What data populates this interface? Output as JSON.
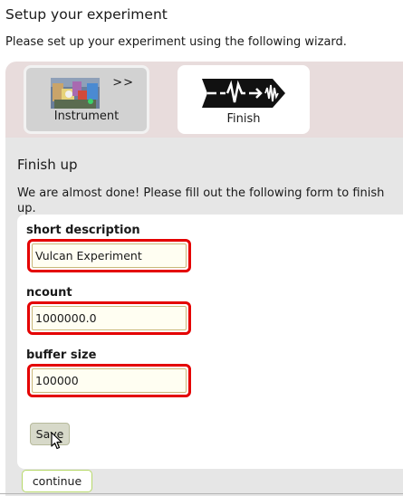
{
  "page": {
    "title": "Setup your experiment",
    "intro": "Please set up your experiment using the following wizard."
  },
  "wizard": {
    "steps": [
      {
        "label": "Instrument",
        "arrow": ">>",
        "icon": "instrument-thumbnail-icon"
      },
      {
        "label": "Finish",
        "icon": "finish-logo-icon"
      }
    ],
    "active_step": "Finish"
  },
  "finish": {
    "title": "Finish up",
    "instructions": "We are almost done! Please fill out the following form to finish up.",
    "fields": [
      {
        "label": "short description",
        "value": "Vulcan Experiment"
      },
      {
        "label": "ncount",
        "value": "1000000.0"
      },
      {
        "label": "buffer size",
        "value": "100000"
      }
    ],
    "save_label": "Save",
    "continue_label": "continue"
  },
  "colors": {
    "wizard_band": "#e8dcdc",
    "panel_bg": "#e6e6e6",
    "field_error_border": "#e40000",
    "continue_border": "#b7d96a"
  }
}
